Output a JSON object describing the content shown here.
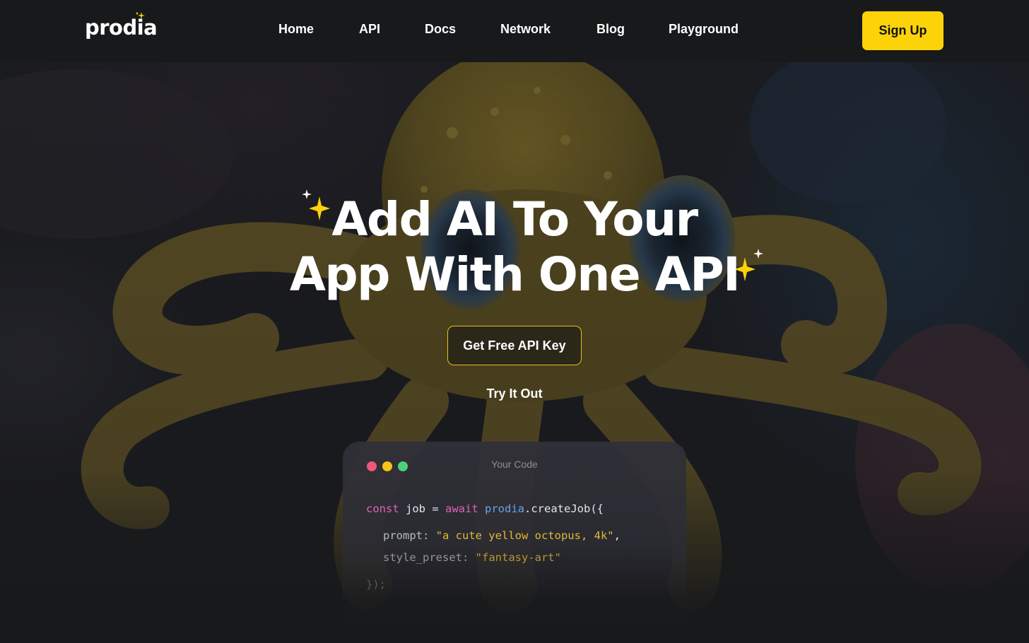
{
  "header": {
    "logo": "prodia",
    "nav": [
      {
        "label": "Home"
      },
      {
        "label": "API"
      },
      {
        "label": "Docs"
      },
      {
        "label": "Network"
      },
      {
        "label": "Blog"
      },
      {
        "label": "Playground"
      }
    ],
    "signup_label": "Sign Up"
  },
  "hero": {
    "headline_line1": "Add AI To Your",
    "headline_line2": "App With One API",
    "cta_label": "Get Free API Key",
    "secondary_label": "Try It Out",
    "background_image": "yellow octopus underwater"
  },
  "code_window": {
    "title": "Your Code",
    "line1": {
      "kw1": "const",
      "name": " job ",
      "eq": "= ",
      "kw2": "await",
      "obj": " prodia",
      "call": ".createJob({"
    },
    "line2": {
      "key": "prompt: ",
      "value": "\"a cute yellow octopus, 4k\"",
      "comma": ","
    },
    "line3": {
      "key": "style_preset: ",
      "value": "\"fantasy-art\""
    },
    "line4": "});"
  },
  "colors": {
    "accent_yellow": "#fcd309",
    "dot_red": "#f0567a",
    "dot_yellow": "#f5c518",
    "dot_green": "#4cd37a"
  }
}
